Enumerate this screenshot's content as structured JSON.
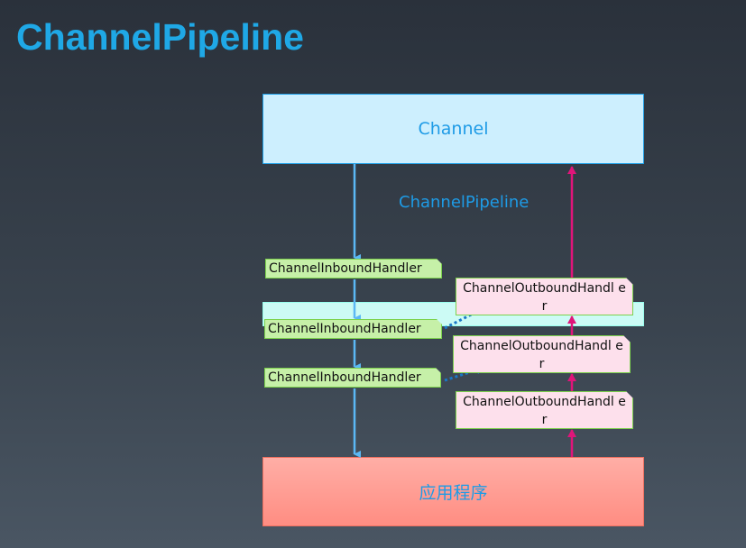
{
  "title": "ChannelPipeline",
  "channel": "Channel",
  "pipeline_label": "ChannelPipeline",
  "inbound": [
    "ChannelInboundHandler",
    "ChannelInboundHandler",
    "ChannelInboundHandler"
  ],
  "outbound": [
    "ChannelOutboundHandl er",
    "ChannelOutboundHandl er",
    "ChannelOutboundHandl er"
  ],
  "application": "应用程序",
  "colors": {
    "inbound_arrow": "#5bb8f5",
    "outbound_arrow": "#e0157a",
    "dotted_arrow": "#1a78c8"
  }
}
